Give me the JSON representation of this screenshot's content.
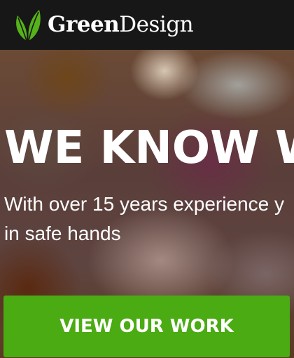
{
  "header": {
    "brand_bold": "Green",
    "brand_light": "Design",
    "logo_icon": "leaf-icon",
    "logo_color": "#56b21a"
  },
  "hero": {
    "title": "WE KNOW W",
    "subtitle_line1": "With over 15 years experience y",
    "subtitle_line2": "in safe hands",
    "cta_label": "VIEW OUR WORK",
    "cta_color": "#4aab12"
  }
}
